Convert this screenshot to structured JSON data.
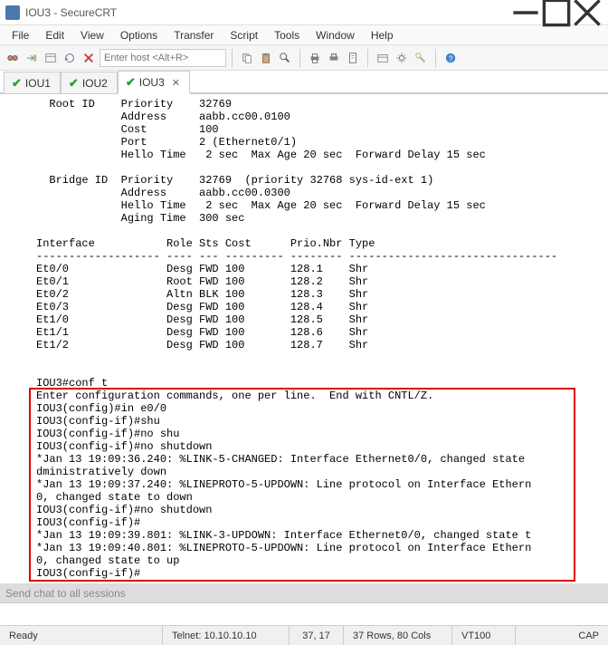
{
  "window": {
    "title": "IOU3 - SecureCRT"
  },
  "menubar": [
    "File",
    "Edit",
    "View",
    "Options",
    "Transfer",
    "Script",
    "Tools",
    "Window",
    "Help"
  ],
  "toolbar": {
    "host_placeholder": "Enter host <Alt+R>"
  },
  "tabs": {
    "items": [
      {
        "label": "IOU1",
        "active": false
      },
      {
        "label": "IOU2",
        "active": false
      },
      {
        "label": "IOU3",
        "active": true
      }
    ]
  },
  "terminal": {
    "root_id": {
      "priority": "32769",
      "address": "aabb.cc00.0100",
      "cost": "100",
      "port": "2 (Ethernet0/1)",
      "hello": "2 sec  Max Age 20 sec  Forward Delay 15 sec"
    },
    "bridge_id": {
      "priority": "32769  (priority 32768 sys-id-ext 1)",
      "address": "aabb.cc00.0300",
      "hello": "2 sec  Max Age 20 sec  Forward Delay 15 sec",
      "aging": "300 sec"
    },
    "interfaces_header": "Interface           Role Sts Cost      Prio.Nbr Type",
    "interfaces": [
      {
        "name": "Et0/0",
        "role": "Desg",
        "sts": "FWD",
        "cost": "100",
        "prio": "128.1",
        "type": "Shr"
      },
      {
        "name": "Et0/1",
        "role": "Root",
        "sts": "FWD",
        "cost": "100",
        "prio": "128.2",
        "type": "Shr"
      },
      {
        "name": "Et0/2",
        "role": "Altn",
        "sts": "BLK",
        "cost": "100",
        "prio": "128.3",
        "type": "Shr"
      },
      {
        "name": "Et0/3",
        "role": "Desg",
        "sts": "FWD",
        "cost": "100",
        "prio": "128.4",
        "type": "Shr"
      },
      {
        "name": "Et1/0",
        "role": "Desg",
        "sts": "FWD",
        "cost": "100",
        "prio": "128.5",
        "type": "Shr"
      },
      {
        "name": "Et1/1",
        "role": "Desg",
        "sts": "FWD",
        "cost": "100",
        "prio": "128.6",
        "type": "Shr"
      },
      {
        "name": "Et1/2",
        "role": "Desg",
        "sts": "FWD",
        "cost": "100",
        "prio": "128.7",
        "type": "Shr"
      }
    ],
    "session_lines": [
      "IOU3#conf t",
      "Enter configuration commands, one per line.  End with CNTL/Z.",
      "IOU3(config)#in e0/0",
      "IOU3(config-if)#shu",
      "IOU3(config-if)#no shu",
      "IOU3(config-if)#no shutdown",
      "*Jan 13 19:09:36.240: %LINK-5-CHANGED: Interface Ethernet0/0, changed state ",
      "dministratively down",
      "*Jan 13 19:09:37.240: %LINEPROTO-5-UPDOWN: Line protocol on Interface Ethern",
      "0, changed state to down",
      "IOU3(config-if)#no shutdown",
      "IOU3(config-if)#",
      "*Jan 13 19:09:39.801: %LINK-3-UPDOWN: Interface Ethernet0/0, changed state t",
      "*Jan 13 19:09:40.801: %LINEPROTO-5-UPDOWN: Line protocol on Interface Ethern",
      "0, changed state to up",
      "IOU3(config-if)#"
    ]
  },
  "chat_hint": "Send chat to all sessions",
  "status": {
    "ready": "Ready",
    "conn": "Telnet: 10.10.10.10",
    "pos": "37, 17",
    "size": "37 Rows, 80 Cols",
    "term": "VT100",
    "cap": "CAP"
  }
}
